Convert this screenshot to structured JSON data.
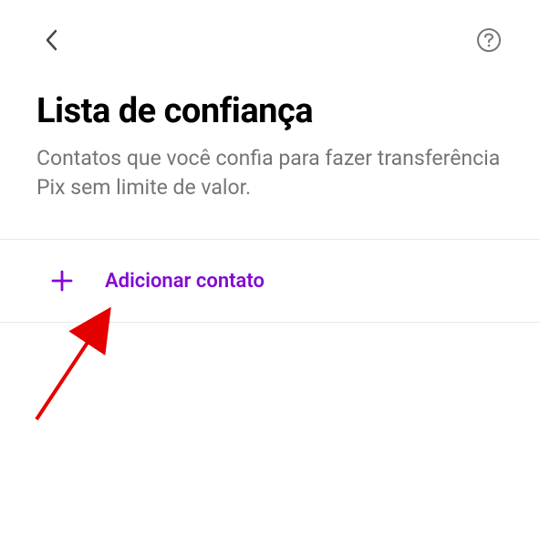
{
  "header": {
    "title": "Lista de confiança",
    "subtitle": "Contatos que você confia para fazer transferência Pix sem limite de valor."
  },
  "actions": {
    "add_contact_label": "Adicionar contato"
  },
  "colors": {
    "accent": "#820ad1",
    "annotation": "#e40000"
  }
}
